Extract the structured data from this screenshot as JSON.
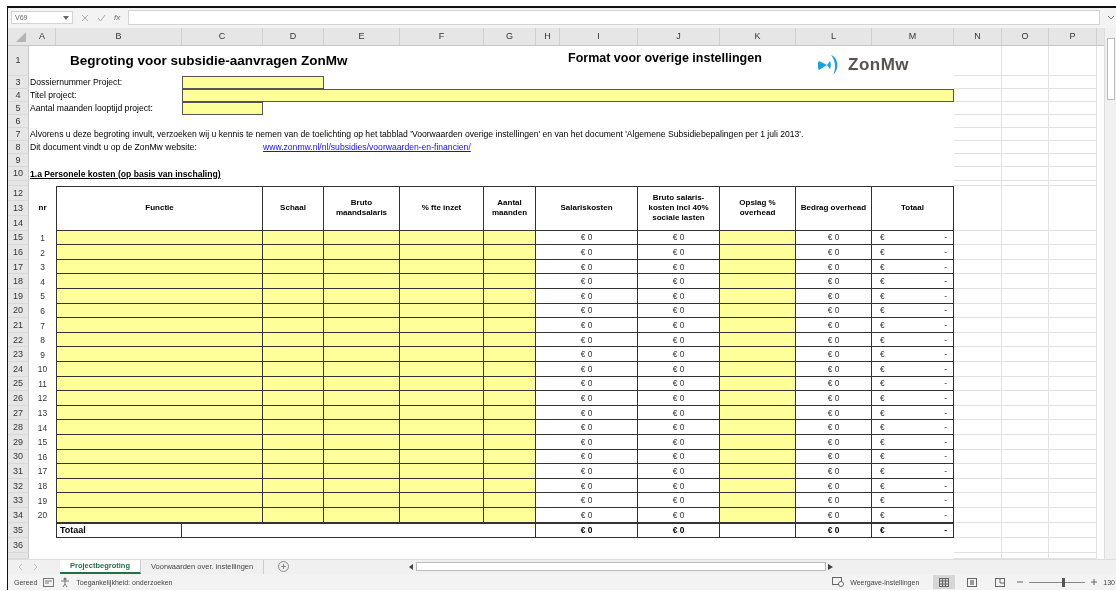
{
  "name_box": "V69",
  "function_label": "fx",
  "columns": [
    "A",
    "B",
    "C",
    "D",
    "E",
    "F",
    "G",
    "H",
    "I",
    "J",
    "K",
    "L",
    "M",
    "N",
    "O",
    "P"
  ],
  "row_headers": [
    "1",
    "3",
    "4",
    "5",
    "6",
    "7",
    "8",
    "9",
    "10",
    "12",
    "13",
    "14",
    "15",
    "16",
    "17",
    "18",
    "19",
    "20",
    "21",
    "22",
    "23",
    "24",
    "25",
    "26",
    "27",
    "28",
    "29",
    "30",
    "31",
    "32",
    "33",
    "34",
    "35",
    "36"
  ],
  "title": "Begroting voor subsidie-aanvragen ZonMw",
  "subtitle": "Format voor overige instellingen",
  "logo": {
    "text": "ZonMw"
  },
  "fields": [
    {
      "label": "Dossiernummer Project:"
    },
    {
      "label": "Titel project:"
    },
    {
      "label": "Aantal maanden looptijd project:"
    }
  ],
  "intro": "Alvorens u deze begroting invult, verzoeken wij u kennis te nemen van de toelichting op het tabblad 'Voorwaarden overige instellingen' en van het document 'Algemene Subsidiebepalingen per 1 juli 2013'.",
  "website": {
    "label": "Dit document vindt u op de ZonMw website:",
    "link": "www.zonmw.nl/nl/subsidies/voorwaarden-en-financien/"
  },
  "section": "1.a Personele kosten (op basis van inschaling)",
  "table": {
    "columns": [
      "nr",
      "Functie",
      "Schaal",
      "Bruto maandsalaris",
      "% fte inzet",
      "Aantal maanden",
      "Salariskosten",
      "Bruto salaris-kosten incl 40% sociale lasten",
      "Opslag % overhead",
      "Bedrag overhead",
      "Totaal"
    ],
    "rows": [
      {
        "nr": "1",
        "salariskosten": "€ 0",
        "bruto_incl": "€ 0",
        "bedrag_overhead": "€ 0",
        "totaal": {
          "currency": "€",
          "amount": "-"
        }
      },
      {
        "nr": "2",
        "salariskosten": "€ 0",
        "bruto_incl": "€ 0",
        "bedrag_overhead": "€ 0",
        "totaal": {
          "currency": "€",
          "amount": "-"
        }
      },
      {
        "nr": "3",
        "salariskosten": "€ 0",
        "bruto_incl": "€ 0",
        "bedrag_overhead": "€ 0",
        "totaal": {
          "currency": "€",
          "amount": "-"
        }
      },
      {
        "nr": "4",
        "salariskosten": "€ 0",
        "bruto_incl": "€ 0",
        "bedrag_overhead": "€ 0",
        "totaal": {
          "currency": "€",
          "amount": "-"
        }
      },
      {
        "nr": "5",
        "salariskosten": "€ 0",
        "bruto_incl": "€ 0",
        "bedrag_overhead": "€ 0",
        "totaal": {
          "currency": "€",
          "amount": "-"
        }
      },
      {
        "nr": "6",
        "salariskosten": "€ 0",
        "bruto_incl": "€ 0",
        "bedrag_overhead": "€ 0",
        "totaal": {
          "currency": "€",
          "amount": "-"
        }
      },
      {
        "nr": "7",
        "salariskosten": "€ 0",
        "bruto_incl": "€ 0",
        "bedrag_overhead": "€ 0",
        "totaal": {
          "currency": "€",
          "amount": "-"
        }
      },
      {
        "nr": "8",
        "salariskosten": "€ 0",
        "bruto_incl": "€ 0",
        "bedrag_overhead": "€ 0",
        "totaal": {
          "currency": "€",
          "amount": "-"
        }
      },
      {
        "nr": "9",
        "salariskosten": "€ 0",
        "bruto_incl": "€ 0",
        "bedrag_overhead": "€ 0",
        "totaal": {
          "currency": "€",
          "amount": "-"
        }
      },
      {
        "nr": "10",
        "salariskosten": "€ 0",
        "bruto_incl": "€ 0",
        "bedrag_overhead": "€ 0",
        "totaal": {
          "currency": "€",
          "amount": "-"
        }
      },
      {
        "nr": "11",
        "salariskosten": "€ 0",
        "bruto_incl": "€ 0",
        "bedrag_overhead": "€ 0",
        "totaal": {
          "currency": "€",
          "amount": "-"
        }
      },
      {
        "nr": "12",
        "salariskosten": "€ 0",
        "bruto_incl": "€ 0",
        "bedrag_overhead": "€ 0",
        "totaal": {
          "currency": "€",
          "amount": "-"
        }
      },
      {
        "nr": "13",
        "salariskosten": "€ 0",
        "bruto_incl": "€ 0",
        "bedrag_overhead": "€ 0",
        "totaal": {
          "currency": "€",
          "amount": "-"
        }
      },
      {
        "nr": "14",
        "salariskosten": "€ 0",
        "bruto_incl": "€ 0",
        "bedrag_overhead": "€ 0",
        "totaal": {
          "currency": "€",
          "amount": "-"
        }
      },
      {
        "nr": "15",
        "salariskosten": "€ 0",
        "bruto_incl": "€ 0",
        "bedrag_overhead": "€ 0",
        "totaal": {
          "currency": "€",
          "amount": "-"
        }
      },
      {
        "nr": "16",
        "salariskosten": "€ 0",
        "bruto_incl": "€ 0",
        "bedrag_overhead": "€ 0",
        "totaal": {
          "currency": "€",
          "amount": "-"
        }
      },
      {
        "nr": "17",
        "salariskosten": "€ 0",
        "bruto_incl": "€ 0",
        "bedrag_overhead": "€ 0",
        "totaal": {
          "currency": "€",
          "amount": "-"
        }
      },
      {
        "nr": "18",
        "salariskosten": "€ 0",
        "bruto_incl": "€ 0",
        "bedrag_overhead": "€ 0",
        "totaal": {
          "currency": "€",
          "amount": "-"
        }
      },
      {
        "nr": "19",
        "salariskosten": "€ 0",
        "bruto_incl": "€ 0",
        "bedrag_overhead": "€ 0",
        "totaal": {
          "currency": "€",
          "amount": "-"
        }
      },
      {
        "nr": "20",
        "salariskosten": "€ 0",
        "bruto_incl": "€ 0",
        "bedrag_overhead": "€ 0",
        "totaal": {
          "currency": "€",
          "amount": "-"
        }
      }
    ],
    "total": {
      "label": "Totaal",
      "salariskosten": "€ 0",
      "bruto_incl": "€ 0",
      "bedrag_overhead": "€ 0",
      "totaal": {
        "currency": "€",
        "amount": "-"
      }
    }
  },
  "sheet_tabs": [
    {
      "label": "Projectbegroting",
      "selected": true
    },
    {
      "label": "Voorwaarden over. instellingen",
      "selected": false
    }
  ],
  "status_bar": {
    "ready": "Gereed",
    "accessibility": "Toegankelijkheid: onderzoeken",
    "display_settings": "Weergave-instellingen",
    "views": [
      {
        "kind": "normal",
        "selected": true
      },
      {
        "kind": "page_layout",
        "selected": false
      },
      {
        "kind": "page_break",
        "selected": false
      }
    ],
    "zoom_slider": {
      "level": 0.6
    },
    "zoom": "130"
  }
}
